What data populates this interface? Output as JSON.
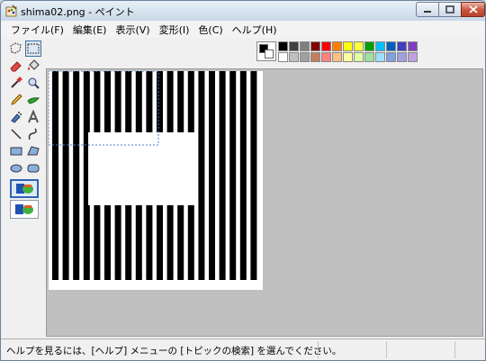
{
  "window": {
    "title": "shima02.png - ペイント"
  },
  "menu": {
    "items": [
      "ファイル(F)",
      "編集(E)",
      "表示(V)",
      "変形(I)",
      "色(C)",
      "ヘルプ(H)"
    ]
  },
  "toolbox": {
    "tools": [
      "free-select-icon",
      "rect-select-icon",
      "eraser-icon",
      "fill-icon",
      "color-picker-icon",
      "magnifier-icon",
      "pencil-icon",
      "brush-icon",
      "airbrush-icon",
      "text-icon",
      "line-icon",
      "curve-icon",
      "rectangle-icon",
      "polygon-icon",
      "ellipse-icon",
      "rounded-rect-icon"
    ],
    "selected_tool": "rect-select-icon"
  },
  "palette": {
    "foreground": "#000000",
    "background": "#ffffff",
    "row1": [
      "#000000",
      "#404040",
      "#808080",
      "#800000",
      "#ff0000",
      "#ff8000",
      "#ffff00",
      "#ffff40",
      "#00a000",
      "#00c0ff",
      "#0060c0",
      "#4040c0",
      "#8040c0"
    ],
    "row2": [
      "#ffffff",
      "#c0c0c0",
      "#a0a0a0",
      "#c08060",
      "#ff8080",
      "#ffc080",
      "#ffffa0",
      "#e0ffa0",
      "#a0e0a0",
      "#a0e0ff",
      "#80a0e0",
      "#a0a0e0",
      "#c0a0e0"
    ]
  },
  "status": {
    "help_text": "ヘルプを見るには、[ヘルプ] メニューの [トピックの検索] を選んでください。"
  }
}
